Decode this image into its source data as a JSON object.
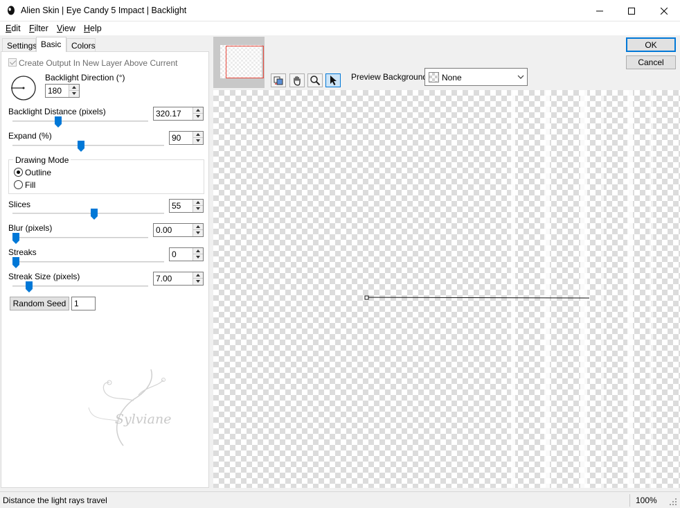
{
  "window": {
    "title": "Alien Skin | Eye Candy 5 Impact | Backlight"
  },
  "menu": [
    {
      "label": "Edit",
      "acc": "E",
      "rest": "dit"
    },
    {
      "label": "Filter",
      "acc": "F",
      "rest": "ilter"
    },
    {
      "label": "View",
      "acc": "V",
      "rest": "iew"
    },
    {
      "label": "Help",
      "acc": "H",
      "rest": "elp"
    }
  ],
  "tabs": {
    "settings": "Settings",
    "basic": "Basic",
    "colors": "Colors"
  },
  "basic": {
    "create_output": "Create Output In New Layer Above Current",
    "backlight_direction": {
      "label": "Backlight Direction (°)",
      "value": "180"
    },
    "backlight_distance": {
      "label": "Backlight Distance (pixels)",
      "value": "320.17",
      "position": 0.33
    },
    "expand": {
      "label": "Expand (%)",
      "value": "90",
      "position": 0.45
    },
    "drawing_mode": {
      "label": "Drawing Mode",
      "options": [
        "Outline",
        "Fill"
      ],
      "selected": "Outline"
    },
    "slices": {
      "label": "Slices",
      "value": "55",
      "position": 0.54
    },
    "blur": {
      "label": "Blur (pixels)",
      "value": "0.00",
      "position": 0.0
    },
    "streaks": {
      "label": "Streaks",
      "value": "0",
      "position": 0.0
    },
    "streak_size": {
      "label": "Streak Size (pixels)",
      "value": "7.00",
      "position": 0.1
    },
    "random_seed": {
      "label": "Random Seed",
      "value": "1"
    }
  },
  "watermark_text": "Sylviane",
  "actions": {
    "ok": "OK",
    "cancel": "Cancel"
  },
  "preview": {
    "background_label": "Preview Background:",
    "background_value": "None"
  },
  "status": {
    "hint": "Distance the light rays travel",
    "zoom": "100%"
  },
  "colors": {
    "accent": "#0078d7",
    "nav_rect": "#e8463a"
  },
  "icons": [
    "eye-candy-logo-icon",
    "minimize-icon",
    "maximize-icon",
    "close-icon",
    "dial-icon",
    "slider-thumb-icon",
    "preview-swap-icon",
    "hand-icon",
    "zoom-icon",
    "pointer-icon",
    "chevron-down-icon",
    "resize-grip-icon"
  ]
}
